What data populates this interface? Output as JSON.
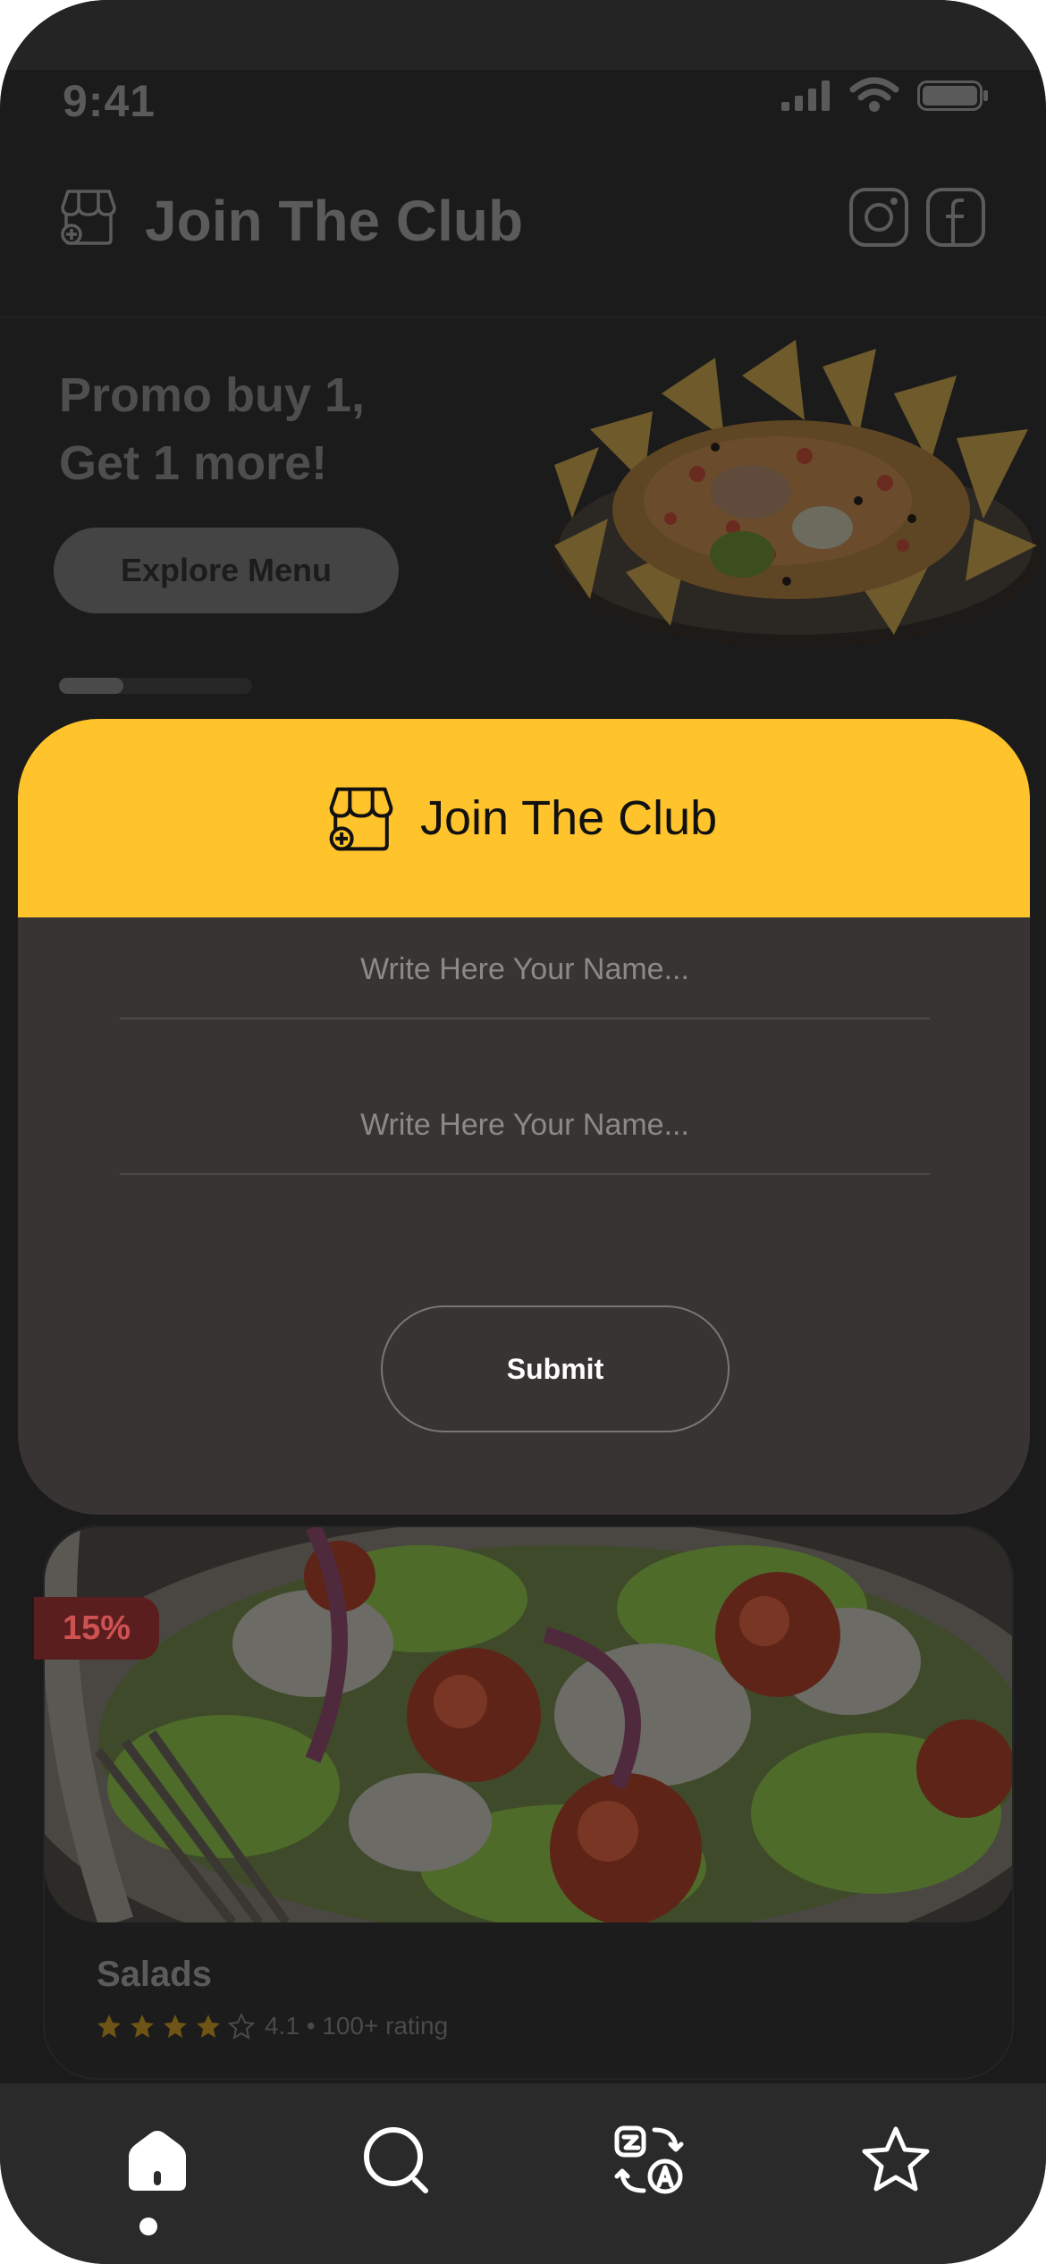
{
  "status_bar": {
    "time": "9:41"
  },
  "header": {
    "title": "Join The Club"
  },
  "promo": {
    "title_line1": "Promo buy 1,",
    "title_line2": "Get 1 more!",
    "button_label": "Explore Menu",
    "carousel_active_index": 0
  },
  "modal": {
    "title": "Join The Club",
    "name_placeholder": "Write Here Your Name...",
    "second_placeholder": "Write Here Your Name...",
    "submit_label": "Submit"
  },
  "product": {
    "name": "Salads",
    "discount": "15%",
    "rating_value": 4.1,
    "rating_text": "4.1 • 100+ rating"
  },
  "tabbar": {
    "active": "home",
    "items": [
      "home",
      "search",
      "translate",
      "favorites"
    ]
  },
  "colors": {
    "accent": "#ffc32b",
    "modal_bg": "#383433",
    "background": "#1b1b1b"
  }
}
